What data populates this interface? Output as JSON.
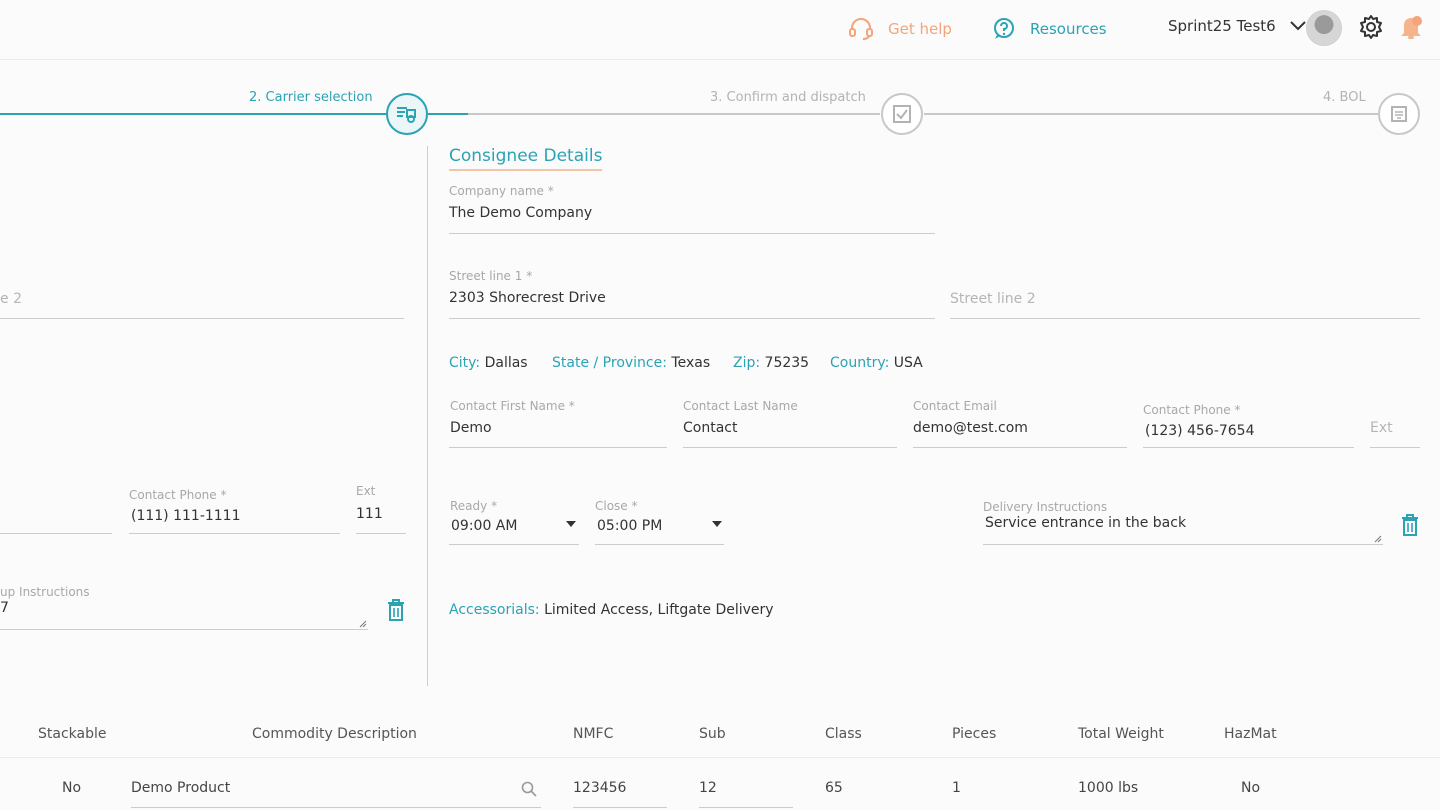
{
  "header": {
    "get_help": "Get help",
    "resources": "Resources",
    "user_name": "Sprint25 Test6"
  },
  "stepper": {
    "steps": [
      {
        "label": "2. Carrier selection",
        "state": "active"
      },
      {
        "label": "3. Confirm and dispatch",
        "state": "pending"
      },
      {
        "label": "4. BOL",
        "state": "pending"
      }
    ]
  },
  "shipper_partial": {
    "street_line_2_placeholder": "e 2",
    "contact_phone_label": "Contact Phone *",
    "contact_phone_value": "(111) 111-1111",
    "ext_label": "Ext",
    "ext_value": "111",
    "pickup_instructions_label": "up Instructions",
    "pickup_instructions_value": "7"
  },
  "consignee": {
    "title": "Consignee Details",
    "company_name_label": "Company name *",
    "company_name_value": "The Demo Company",
    "street1_label": "Street line 1 *",
    "street1_value": "2303 Shorecrest Drive",
    "street2_placeholder": "Street line 2",
    "city_label": "City:",
    "city_value": "Dallas",
    "state_label": "State / Province:",
    "state_value": "Texas",
    "zip_label": "Zip:",
    "zip_value": "75235",
    "country_label": "Country:",
    "country_value": "USA",
    "first_name_label": "Contact First Name *",
    "first_name_value": "Demo",
    "last_name_label": "Contact Last Name",
    "last_name_value": "Contact",
    "email_label": "Contact Email",
    "email_value": "demo@test.com",
    "phone_label": "Contact Phone *",
    "phone_value": "(123) 456-7654",
    "ext_placeholder": "Ext",
    "ready_label": "Ready *",
    "ready_value": "09:00 AM",
    "close_label": "Close *",
    "close_value": "05:00 PM",
    "delivery_label": "Delivery Instructions",
    "delivery_value": "Service entrance in the back",
    "accessorials_label": "Accessorials:",
    "accessorials_value": "Limited Access, Liftgate Delivery"
  },
  "table": {
    "headers": [
      "Stackable",
      "Commodity Description",
      "NMFC",
      "Sub",
      "Class",
      "Pieces",
      "Total Weight",
      "HazMat"
    ],
    "row": {
      "stackable": "No",
      "description": "Demo Product",
      "nmfc": "123456",
      "sub": "12",
      "class": "65",
      "pieces": "1",
      "weight": "1000 lbs",
      "hazmat": "No"
    }
  },
  "colors": {
    "accent": "#2aa3b4",
    "help": "#f3a47a"
  }
}
